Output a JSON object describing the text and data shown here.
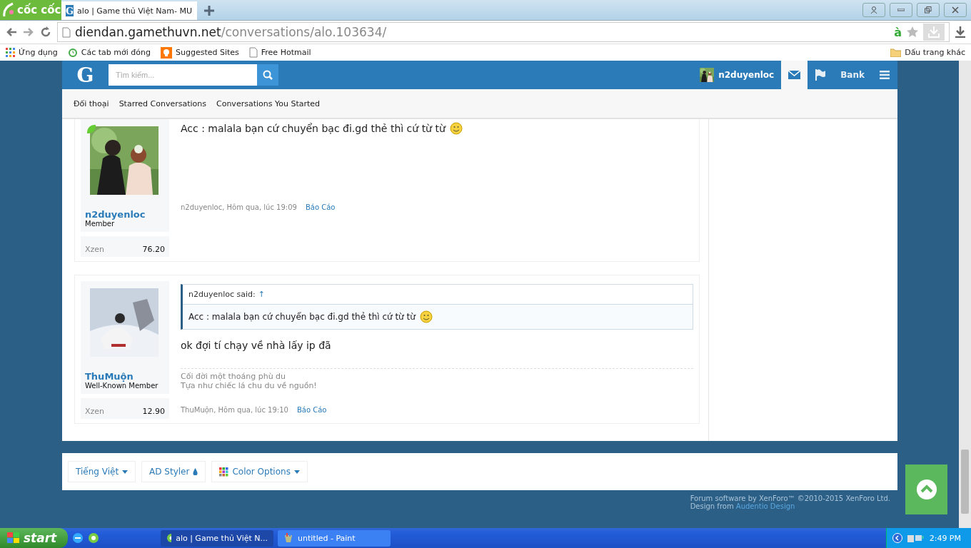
{
  "browser": {
    "brand": "cốc cốc",
    "favicon": "G",
    "tabs": [
      {
        "label": "alo | Game thủ Việt Nam- MU",
        "selected": true
      }
    ],
    "url": {
      "host": "diendan.gamethuvn.net",
      "path": "/conversations/alo.103634/"
    },
    "ime_indicator": "à",
    "bookmarks": [
      {
        "label": "Ứng dụng",
        "kind": "apps"
      },
      {
        "label": "Các tab mới đóng",
        "kind": "history"
      },
      {
        "label": "Suggested Sites",
        "kind": "bulb"
      },
      {
        "label": "Free Hotmail",
        "kind": "page"
      }
    ],
    "other_bookmarks": "Dấu trang khác"
  },
  "site": {
    "logo": "G",
    "search": {
      "placeholder": "Tìm kiếm..."
    },
    "user": "n2duyenloc",
    "nav": [
      {
        "kind": "mail",
        "selected": true
      },
      {
        "kind": "flag",
        "selected": false
      },
      {
        "kind": "text",
        "label": "Bank",
        "selected": false
      },
      {
        "kind": "menu",
        "selected": false
      }
    ],
    "subnav": [
      "Đối thoại",
      "Starred Conversations",
      "Conversations You Started"
    ]
  },
  "messages": [
    {
      "author": "n2duyenloc",
      "role": "Member",
      "online": true,
      "stat_label": "Xzen",
      "stat_value": "76.20",
      "text": "Acc : malala bạn cứ chuyển bạc đi.gd thẻ thì cứ từ từ",
      "meta": "n2duyenloc, Hôm qua, lúc 19:09",
      "report": "Báo Cáo"
    },
    {
      "author": "ThuMuộn",
      "role": "Well-Known Member",
      "online": false,
      "stat_label": "Xzen",
      "stat_value": "12.90",
      "quote": {
        "attribution": "n2duyenloc said:",
        "jump": "↑",
        "text": "Acc : malala bạn cứ chuyển bạc đi.gd thẻ thì cứ từ từ"
      },
      "text": "ok đợi tí chạy về nhà lấy ip đã",
      "signature": [
        "Cối đời một thoáng phù du",
        "Tựa như chiếc lá chu du về nguồn!"
      ],
      "meta": "ThuMuộn, Hôm qua, lúc 19:10",
      "report": "Báo Cáo"
    }
  ],
  "footer": {
    "buttons": [
      {
        "label": "Tiếng Việt",
        "kind": "caret"
      },
      {
        "label": "AD Styler",
        "kind": "drop"
      },
      {
        "label": "Color Options",
        "kind": "palette"
      }
    ],
    "copyright": "Forum software by XenForo™ ©2010-2015 XenForo Ltd.",
    "design_prefix": "Design from",
    "design_link": "Audentio Design"
  },
  "taskbar": {
    "start": "start",
    "items": [
      {
        "label": "alo | Game thủ Việt N...",
        "kind": "browser",
        "selected": true
      },
      {
        "label": "untitled - Paint",
        "kind": "paint",
        "selected": false
      }
    ],
    "clock": "2:49 PM"
  }
}
